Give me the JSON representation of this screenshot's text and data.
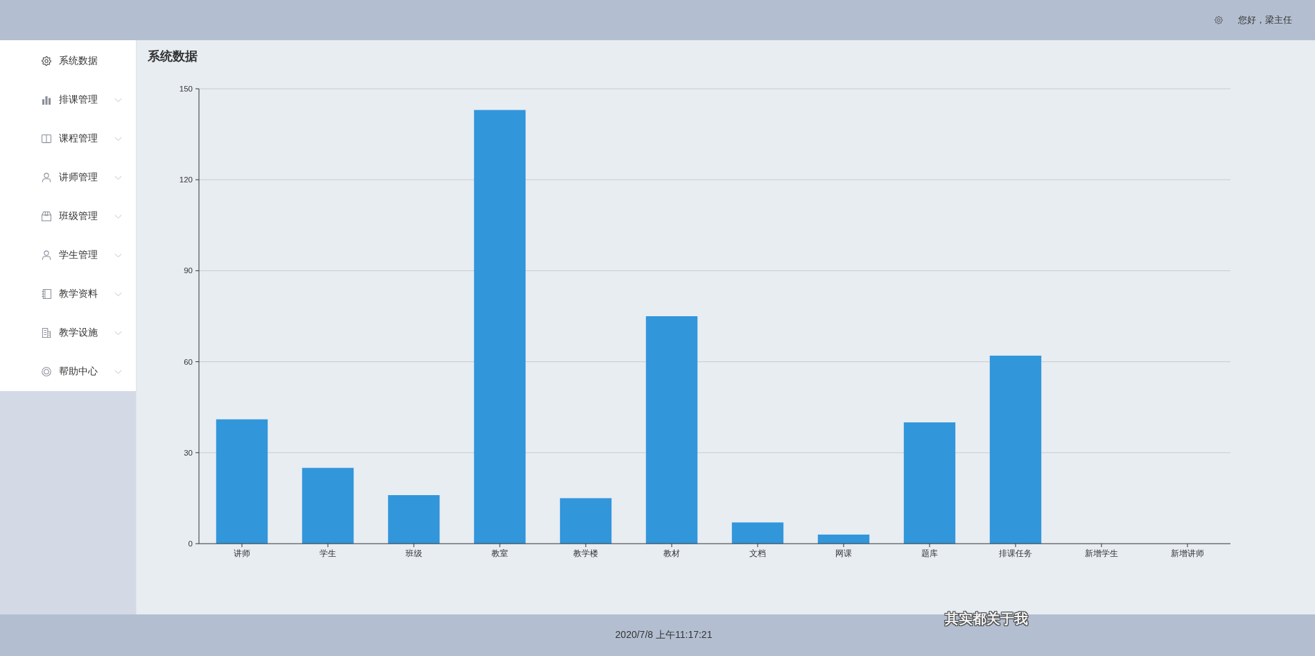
{
  "header": {
    "greeting": "您好，梁主任"
  },
  "sidebar": {
    "items": [
      {
        "label": "系统数据",
        "kind": "link"
      },
      {
        "label": "排课管理",
        "kind": "submenu"
      },
      {
        "label": "课程管理",
        "kind": "submenu"
      },
      {
        "label": "讲师管理",
        "kind": "submenu"
      },
      {
        "label": "班级管理",
        "kind": "submenu"
      },
      {
        "label": "学生管理",
        "kind": "submenu"
      },
      {
        "label": "教学资料",
        "kind": "submenu"
      },
      {
        "label": "教学设施",
        "kind": "submenu"
      },
      {
        "label": "帮助中心",
        "kind": "submenu"
      }
    ]
  },
  "panel": {
    "title": "系统数据",
    "chart_data": {
      "type": "bar",
      "categories": [
        "讲师",
        "学生",
        "班级",
        "教室",
        "教学楼",
        "教材",
        "文档",
        "网课",
        "题库",
        "排课任务",
        "新增学生",
        "新增讲师"
      ],
      "values": [
        41,
        25,
        16,
        143,
        15,
        75,
        7,
        3,
        40,
        62,
        0,
        0
      ],
      "ylim": [
        0,
        150
      ],
      "yticks": [
        0,
        30,
        60,
        90,
        120,
        150
      ],
      "grid": true
    }
  },
  "footer": {
    "datetime": "2020/7/8 上午11:17:21"
  },
  "lyrics_overlay": {
    "text": "其实都关于我"
  }
}
